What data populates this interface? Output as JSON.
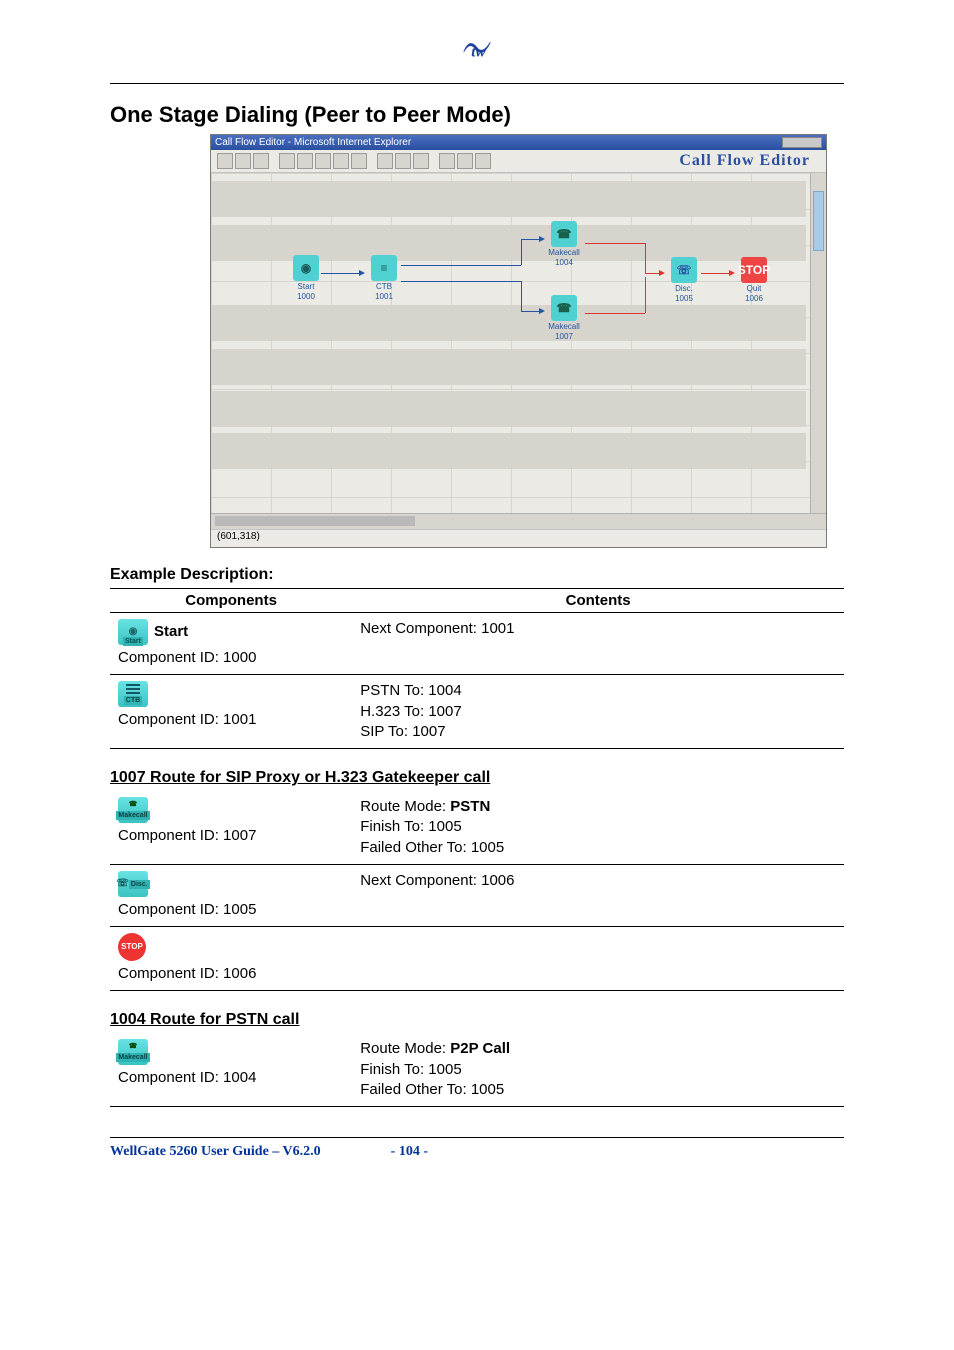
{
  "logo_text": "tw",
  "section_title": "One Stage Dialing (Peer to Peer Mode)",
  "screenshot": {
    "window_title": "Call Flow Editor - Microsoft Internet Explorer",
    "banner": "Call Flow Editor",
    "status": "(601,318)",
    "nodes": {
      "start": {
        "label": "Start",
        "id": "1000"
      },
      "ctb": {
        "label": "CTB",
        "id": "1001"
      },
      "make1": {
        "label": "Makecall",
        "id": "1004"
      },
      "make2": {
        "label": "Makecall",
        "id": "1007"
      },
      "disc": {
        "label": "Disc.",
        "id": "1005"
      },
      "quit": {
        "label": "Quit",
        "id": "1006"
      }
    }
  },
  "example_heading": "Example Description:",
  "table1": {
    "headers": {
      "components": "Components",
      "contents": "Contents"
    },
    "rows": [
      {
        "comp_label": "Start",
        "comp_id_text": "Component ID: 1000",
        "contents": "Next Component: 1001"
      },
      {
        "comp_label": "",
        "comp_id_text": "Component ID: 1001",
        "contents_lines": [
          "PSTN To: 1004",
          "H.323 To: 1007",
          "SIP To: 1007"
        ]
      }
    ]
  },
  "route_sip_heading": "1007 Route for SIP Proxy or H.323 Gatekeeper call",
  "table2": {
    "rows": [
      {
        "comp_id_text": "Component ID: 1007",
        "route_mode_label": "Route Mode: ",
        "route_mode_value": "PSTN",
        "finish": "Finish To: 1005",
        "failed": "Failed Other To: 1005"
      },
      {
        "comp_id_text": "Component ID: 1005",
        "contents": "Next Component: 1006"
      },
      {
        "comp_id_text": "Component ID: 1006",
        "contents": ""
      }
    ]
  },
  "route_pstn_heading": "1004 Route for PSTN call",
  "table3": {
    "row": {
      "comp_id_text": "Component ID: 1004",
      "route_mode_label": "Route Mode: ",
      "route_mode_value": "P2P Call",
      "finish": "Finish To: 1005",
      "failed": "Failed Other To: 1005"
    }
  },
  "footer": {
    "product": "WellGate 5260 User Guide – V6.2.0",
    "page": "- 104 -"
  }
}
